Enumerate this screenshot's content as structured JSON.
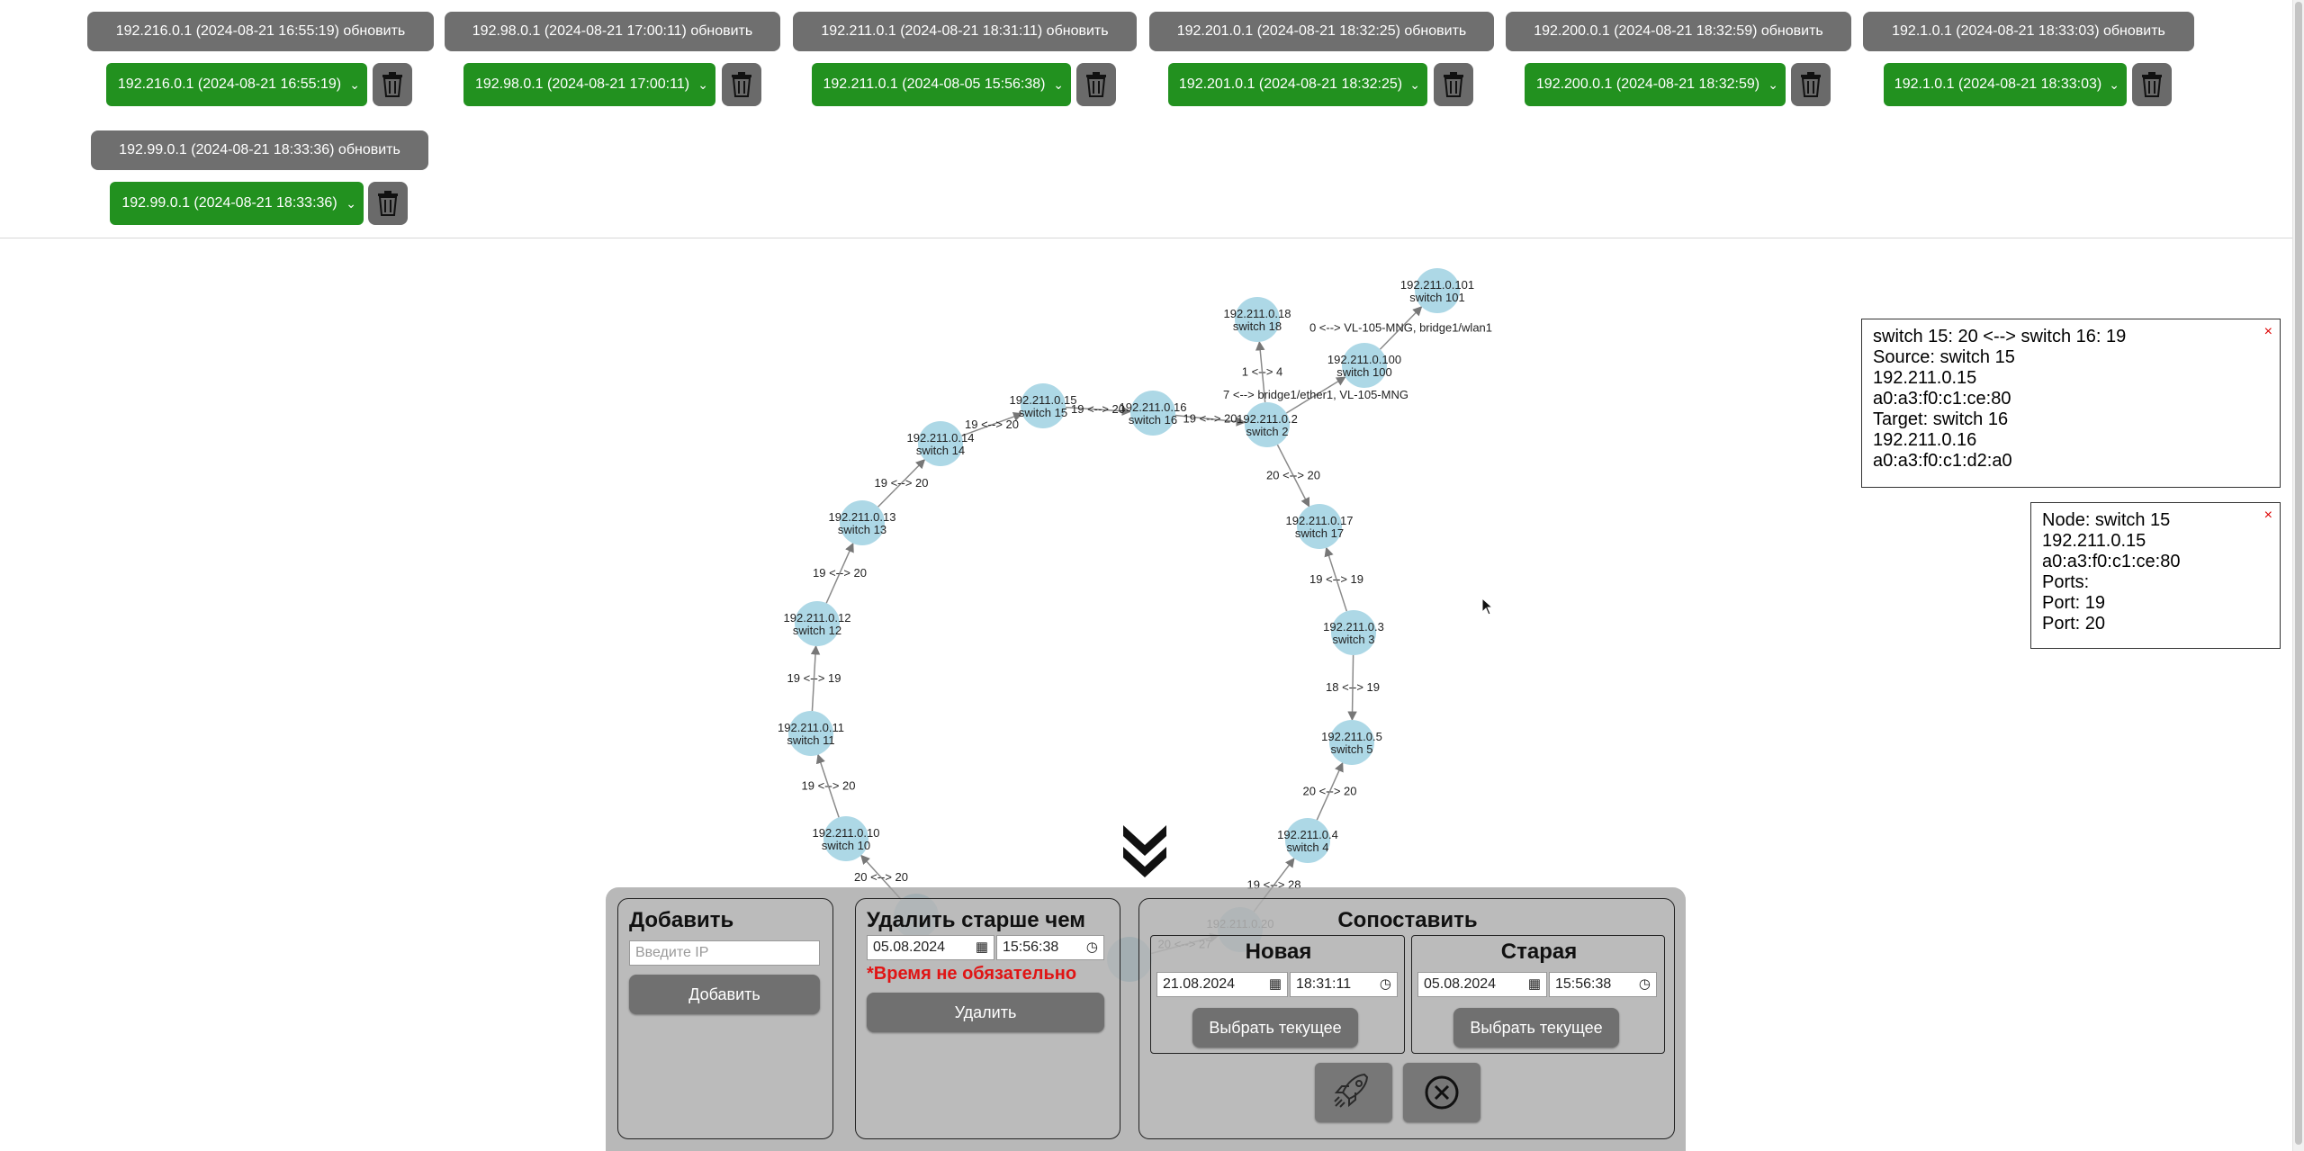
{
  "sources": [
    {
      "update_label": "192.216.0.1 (2024-08-21 16:55:19) обновить",
      "selected": "192.216.0.1 (2024-08-21 16:55:19)"
    },
    {
      "update_label": "192.98.0.1 (2024-08-21 17:00:11) обновить",
      "selected": "192.98.0.1 (2024-08-21 17:00:11)"
    },
    {
      "update_label": "192.211.0.1 (2024-08-21 18:31:11) обновить",
      "selected": "192.211.0.1 (2024-08-05 15:56:38)"
    },
    {
      "update_label": "192.201.0.1 (2024-08-21 18:32:25) обновить",
      "selected": "192.201.0.1 (2024-08-21 18:32:25)"
    },
    {
      "update_label": "192.200.0.1 (2024-08-21 18:32:59) обновить",
      "selected": "192.200.0.1 (2024-08-21 18:32:59)"
    },
    {
      "update_label": "192.1.0.1 (2024-08-21 18:33:03) обновить",
      "selected": "192.1.0.1 (2024-08-21 18:33:03)"
    },
    {
      "update_label": "192.99.0.1 (2024-08-21 18:33:36) обновить",
      "selected": "192.99.0.1 (2024-08-21 18:33:36)"
    }
  ],
  "graph": {
    "nodes": [
      {
        "id": "n101",
        "ip": "192.211.0.101",
        "name": "switch 101"
      },
      {
        "id": "n18",
        "ip": "192.211.0.18",
        "name": "switch 18"
      },
      {
        "id": "n100",
        "ip": "192.211.0.100",
        "name": "switch 100"
      },
      {
        "id": "n15",
        "ip": "192.211.0.15",
        "name": "switch 15"
      },
      {
        "id": "n16",
        "ip": "192.211.0.16",
        "name": "switch 16"
      },
      {
        "id": "n2",
        "ip": "192.211.0.2",
        "name": "switch 2"
      },
      {
        "id": "n14",
        "ip": "192.211.0.14",
        "name": "switch 14"
      },
      {
        "id": "n13",
        "ip": "192.211.0.13",
        "name": "switch 13"
      },
      {
        "id": "n17",
        "ip": "192.211.0.17",
        "name": "switch 17"
      },
      {
        "id": "n12",
        "ip": "192.211.0.12",
        "name": "switch 12"
      },
      {
        "id": "n3",
        "ip": "192.211.0.3",
        "name": "switch 3"
      },
      {
        "id": "n11",
        "ip": "192.211.0.11",
        "name": "switch 11"
      },
      {
        "id": "n5",
        "ip": "192.211.0.5",
        "name": "switch 5"
      },
      {
        "id": "n10",
        "ip": "192.211.0.10",
        "name": "switch 10"
      },
      {
        "id": "n4",
        "ip": "192.211.0.4",
        "name": "switch 4"
      },
      {
        "id": "n20",
        "ip": "192.211.0.20",
        "name": ""
      },
      {
        "id": "n9",
        "ip": "",
        "name": ""
      },
      {
        "id": "n19",
        "ip": "",
        "name": ""
      }
    ],
    "edges": [
      {
        "from": "n100",
        "to": "n101",
        "label": "0 <--> VL-105-MNG, bridge1/wlan1"
      },
      {
        "from": "n2",
        "to": "n18",
        "label": "1 <--> 4"
      },
      {
        "from": "n2",
        "to": "n100",
        "label": "7 <--> bridge1/ether1, VL-105-MNG"
      },
      {
        "from": "n15",
        "to": "n16",
        "label": "19 <--> 20"
      },
      {
        "from": "n16",
        "to": "n2",
        "label": "19 <--> 20"
      },
      {
        "from": "n14",
        "to": "n15",
        "label": "19 <--> 20"
      },
      {
        "from": "n13",
        "to": "n14",
        "label": "19 <--> 20"
      },
      {
        "from": "n2",
        "to": "n17",
        "label": "20 <--> 20"
      },
      {
        "from": "n12",
        "to": "n13",
        "label": "19 <--> 20"
      },
      {
        "from": "n3",
        "to": "n17",
        "label": "19 <--> 19"
      },
      {
        "from": "n11",
        "to": "n12",
        "label": "19 <--> 19"
      },
      {
        "from": "n3",
        "to": "n5",
        "label": "18 <--> 19"
      },
      {
        "from": "n10",
        "to": "n11",
        "label": "19 <--> 20"
      },
      {
        "from": "n4",
        "to": "n5",
        "label": "20 <--> 20"
      },
      {
        "from": "n9",
        "to": "n10",
        "label": "20 <--> 20"
      },
      {
        "from": "n20",
        "to": "n4",
        "label": "19 <--> 28"
      },
      {
        "from": "n19",
        "to": "n20",
        "label": "20 <--> 27"
      }
    ]
  },
  "link_info": {
    "close": "×",
    "lines": [
      "switch 15: 20 <--> switch 16: 19",
      "Source: switch 15",
      "192.211.0.15",
      "a0:a3:f0:c1:ce:80",
      "Target: switch 16",
      "192.211.0.16",
      "a0:a3:f0:c1:d2:a0"
    ]
  },
  "node_info": {
    "close": "×",
    "lines": [
      "Node: switch 15",
      "192.211.0.15",
      "a0:a3:f0:c1:ce:80",
      "Ports:",
      "Port: 19",
      "Port: 20"
    ]
  },
  "panel": {
    "add": {
      "title": "Добавить",
      "placeholder": "Введите IP",
      "button": "Добавить"
    },
    "delete": {
      "title": "Удалить старше чем",
      "date": "05.08.2024",
      "time": "15:56:38",
      "note": "*Время не обязательно",
      "button": "Удалить"
    },
    "compare": {
      "title": "Сопоставить",
      "new": {
        "title": "Новая",
        "date": "21.08.2024",
        "time": "18:31:11",
        "button": "Выбрать текущее"
      },
      "old": {
        "title": "Старая",
        "date": "05.08.2024",
        "time": "15:56:38",
        "button": "Выбрать текущее"
      }
    }
  },
  "icons": {
    "collapse": "chevrons-down-icon",
    "trash": "trash-icon",
    "launch": "rocket-icon",
    "cancel": "close-circle-icon",
    "calendar": "calendar-icon",
    "clock": "clock-icon"
  },
  "colors": {
    "select_green": "#22911f",
    "button_gray": "#707070",
    "node_fill": "#add8e6",
    "warn_red": "#e01414"
  }
}
